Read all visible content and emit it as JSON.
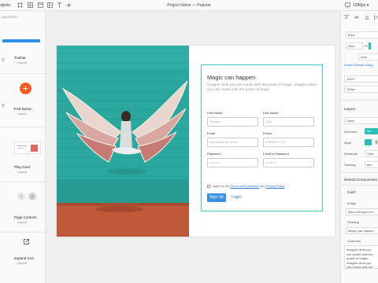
{
  "topbar": {
    "left_label": "ojects",
    "title": "Project Name — Popular",
    "zoom": "1280px ▾",
    "icons": [
      "frame-icon",
      "grid-icon",
      "columns-icon",
      "layout-icon",
      "text-icon",
      "plus-icon"
    ]
  },
  "leftpanel": {
    "section": "mponents",
    "items": [
      {
        "name": "Toolbar",
        "sub": "Layout"
      },
      {
        "name": "FAB Button",
        "sub": "Layout"
      },
      {
        "name": "Play Card",
        "sub": "Layout"
      },
      {
        "name": "Page Controls",
        "sub": "Layout"
      },
      {
        "name": "Expand Icon",
        "sub": "Layout"
      }
    ],
    "accent": "#ff5722"
  },
  "card": {
    "heading": "Magic can happen",
    "paragraph": "Imagine what you can create with the power of magic. Imagine what you can create with the power of magic.",
    "fields": [
      {
        "label": "First Name",
        "placeholder": "Thomas"
      },
      {
        "label": "Last Name",
        "placeholder": "Cole"
      },
      {
        "label": "Email",
        "placeholder": "thomas@cole.co.uk"
      },
      {
        "label": "Phone",
        "placeholder": "1 555 347 704"
      },
      {
        "label": "Password",
        "placeholder": "••••••••••"
      },
      {
        "label": "Confirm Password",
        "placeholder": "••••••••••"
      }
    ],
    "agree_prefix": "I agree to the",
    "terms_link": "Terms and Conditions",
    "agree_and": "and",
    "privacy_link": "Privacy Policy",
    "signup": "Sign Up",
    "login": "Login",
    "border_color": "#3fd0c9"
  },
  "rightpanel": {
    "x_value": "60px",
    "width_value": "40px",
    "auto_value": "Auto",
    "link": "Enable Min/Max Sizing",
    "w_percent": "100%",
    "h_value": "200px",
    "layout_label": "Layout",
    "stack_value": "Stack",
    "direction_label": "Direction",
    "direction_chip": "Ver",
    "align_label": "Align",
    "distribute_label": "Distribute",
    "distribute_value": "Start",
    "spacing_label": "Spacing",
    "spacing_value": "8px",
    "nested_label": "Nested Components",
    "card_label": "Card",
    "image_label": "Image",
    "image_value": "https://images.uns",
    "heading_label": "Heading",
    "heading_value": "Magic can happen",
    "summary_label": "Summary",
    "summary_value": "Imagine what you can create with the power of magic. Imagine what you can create with the power of magic.",
    "teal": "#29c1b5"
  }
}
